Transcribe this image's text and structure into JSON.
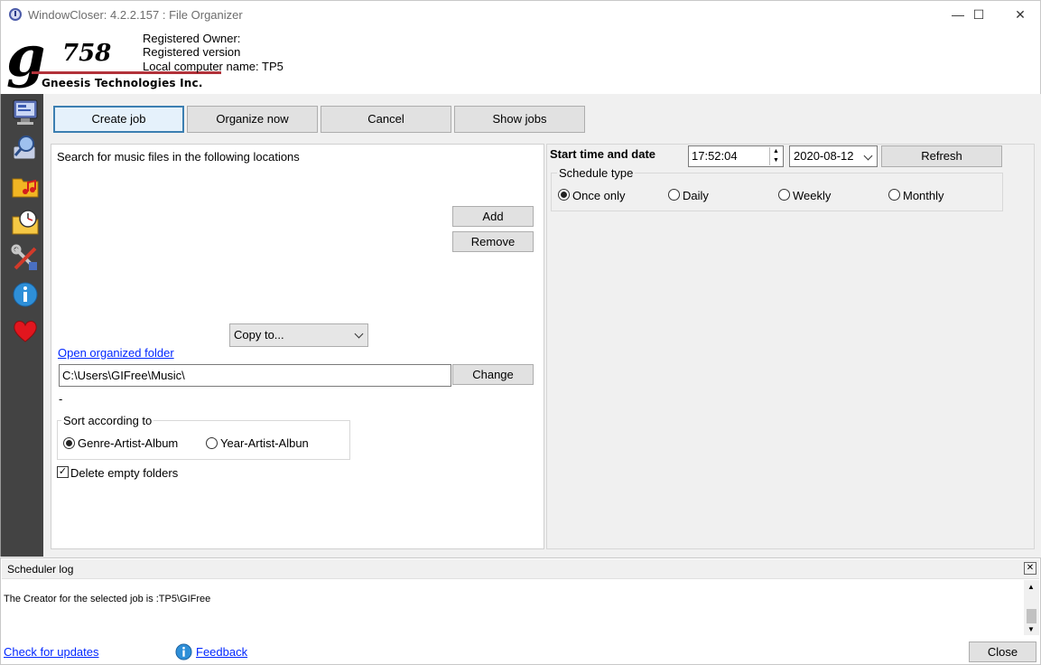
{
  "window": {
    "title": "WindowCloser: 4.2.2.157 : File Organizer",
    "minimize": "—",
    "maximize": "☐",
    "close": "✕"
  },
  "header": {
    "logo_g": "g",
    "logo_number": "758",
    "company": "Gneesis Technologies Inc.",
    "registered_owner": "Registered Owner:",
    "registered_version": "Registered version",
    "computer_name": "Local computer name: TP5"
  },
  "sidebar": {
    "icons": [
      "monitor-settings-icon",
      "search-computer-icon",
      "music-folder-icon",
      "scheduled-folder-icon",
      "tools-icon",
      "info-icon",
      "heart-icon"
    ]
  },
  "tabs": [
    {
      "label": "Create job",
      "active": true
    },
    {
      "label": "Organize now",
      "active": false
    },
    {
      "label": "Cancel",
      "active": false
    },
    {
      "label": "Show jobs",
      "active": false
    }
  ],
  "locations": {
    "heading": "Search for music files in the following locations",
    "add_label": "Add",
    "remove_label": "Remove"
  },
  "action_select": {
    "value": "Copy to..."
  },
  "organized_folder": {
    "link_label": "Open organized folder",
    "path": "C:\\Users\\GIFree\\Music\\",
    "change_label": "Change",
    "dash": "-"
  },
  "sort": {
    "title": "Sort according to",
    "options": [
      "Genre-Artist-Album",
      "Year-Artist-Albun"
    ],
    "selected": 0
  },
  "delete_empty": {
    "label": "Delete empty folders",
    "checked": true
  },
  "schedule": {
    "start_label": "Start time and date",
    "time": "17:52:04",
    "date": "2020-08-12",
    "refresh_label": "Refresh",
    "type_title": "Schedule type",
    "options": [
      "Once only",
      "Daily",
      "Weekly",
      "Monthly"
    ],
    "selected": 0
  },
  "log": {
    "title": "Scheduler log",
    "message": "The Creator for the selected job is :TP5\\GIFree"
  },
  "footer": {
    "check_updates": "Check for updates",
    "feedback": "Feedback",
    "close_label": "Close"
  }
}
